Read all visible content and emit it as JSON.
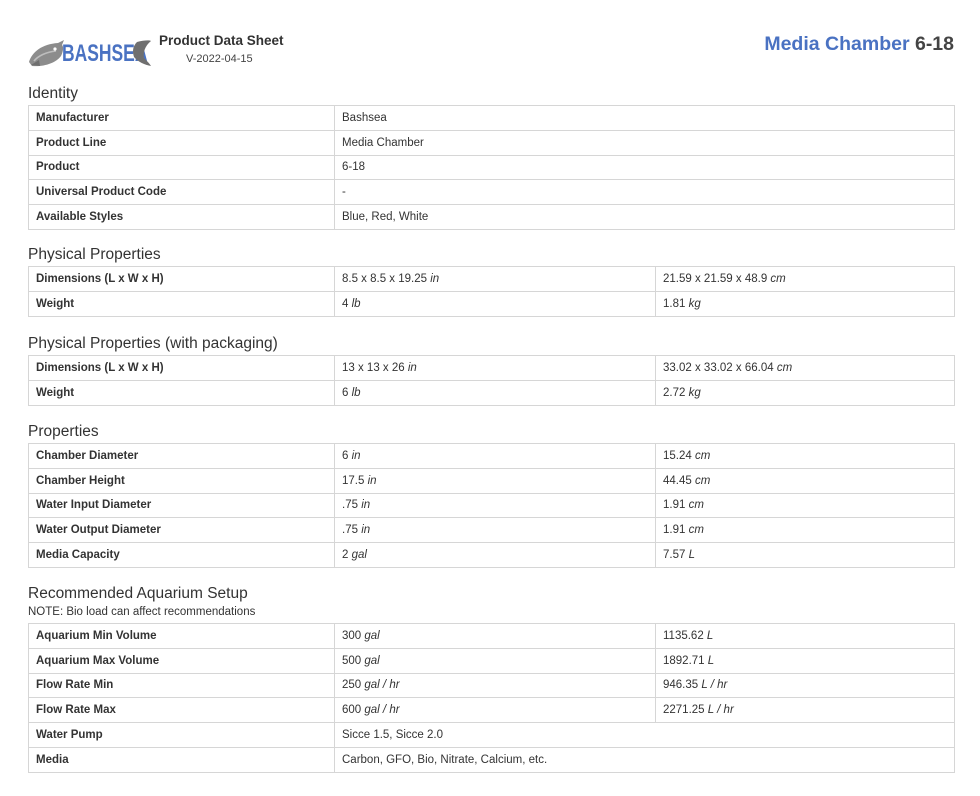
{
  "brand": {
    "logo_text": "BASHSEA"
  },
  "header": {
    "doc_title": "Product Data Sheet",
    "version": "V-2022-04-15",
    "product_name": "Media Chamber",
    "product_model": "6-18"
  },
  "identity": {
    "title": "Identity",
    "rows": [
      {
        "label": "Manufacturer",
        "value": "Bashsea"
      },
      {
        "label": "Product Line",
        "value": "Media Chamber"
      },
      {
        "label": "Product",
        "value": "6-18"
      },
      {
        "label": "Universal Product Code",
        "value": "-"
      },
      {
        "label": "Available Styles",
        "value": "Blue, Red, White"
      }
    ]
  },
  "physical": {
    "title": "Physical Properties",
    "rows": [
      {
        "label": "Dimensions (L x W x H)",
        "v1": "8.5 x 8.5 x 19.25",
        "u1": "in",
        "v2": "21.59 x 21.59 x 48.9",
        "u2": "cm"
      },
      {
        "label": "Weight",
        "v1": "4",
        "u1": "lb",
        "v2": "1.81",
        "u2": "kg"
      }
    ]
  },
  "packaging": {
    "title": "Physical Properties (with packaging)",
    "rows": [
      {
        "label": "Dimensions (L x W x H)",
        "v1": "13 x 13 x 26",
        "u1": "in",
        "v2": "33.02 x 33.02 x 66.04",
        "u2": "cm"
      },
      {
        "label": "Weight",
        "v1": "6",
        "u1": "lb",
        "v2": "2.72",
        "u2": "kg"
      }
    ]
  },
  "properties": {
    "title": "Properties",
    "rows": [
      {
        "label": "Chamber Diameter",
        "v1": "6",
        "u1": "in",
        "v2": "15.24",
        "u2": "cm"
      },
      {
        "label": "Chamber Height",
        "v1": "17.5",
        "u1": "in",
        "v2": "44.45",
        "u2": "cm"
      },
      {
        "label": "Water Input Diameter",
        "v1": ".75",
        "u1": "in",
        "v2": "1.91",
        "u2": "cm"
      },
      {
        "label": "Water Output Diameter",
        "v1": ".75",
        "u1": "in",
        "v2": "1.91",
        "u2": "cm"
      },
      {
        "label": "Media Capacity",
        "v1": "2",
        "u1": "gal",
        "v2": "7.57",
        "u2": "L"
      }
    ]
  },
  "setup": {
    "title": "Recommended Aquarium Setup",
    "note": "NOTE: Bio load can affect recommendations",
    "rows": [
      {
        "label": "Aquarium Min Volume",
        "v1": "300",
        "u1": "gal",
        "v2": "1135.62",
        "u2": "L"
      },
      {
        "label": "Aquarium Max Volume",
        "v1": "500",
        "u1": "gal",
        "v2": "1892.71",
        "u2": "L"
      },
      {
        "label": "Flow Rate Min",
        "v1": "250",
        "u1": "gal / hr",
        "v2": "946.35",
        "u2": "L / hr"
      },
      {
        "label": "Flow Rate Max",
        "v1": "600",
        "u1": "gal / hr",
        "v2": "2271.25",
        "u2": "L / hr"
      }
    ],
    "text_rows": [
      {
        "label": "Water Pump",
        "value": "Sicce 1.5, Sicce 2.0"
      },
      {
        "label": "Media",
        "value": "Carbon, GFO, Bio, Nitrate, Calcium, etc."
      }
    ]
  }
}
